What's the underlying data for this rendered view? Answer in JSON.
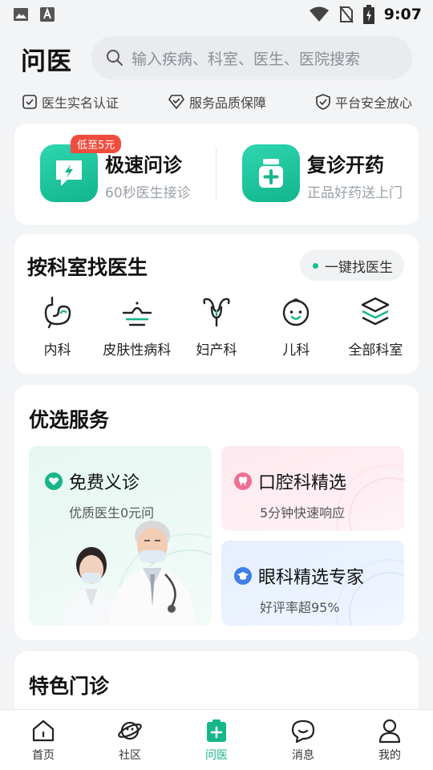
{
  "status_bar": {
    "time": "9:07"
  },
  "header": {
    "title": "问医",
    "search_placeholder": "输入疾病、科室、医生、医院搜索"
  },
  "trust": [
    {
      "label": "医生实名认证",
      "icon": "checkbox-icon"
    },
    {
      "label": "服务品质保障",
      "icon": "diamond-check-icon"
    },
    {
      "label": "平台安全放心",
      "icon": "shield-check-icon"
    }
  ],
  "quick": {
    "consult": {
      "badge": "低至5元",
      "title": "极速问诊",
      "subtitle": "60秒医生接诊"
    },
    "refill": {
      "title": "复诊开药",
      "subtitle": "正品好药送上门"
    }
  },
  "department": {
    "title": "按科室找医生",
    "find_button": "一键找医生",
    "items": [
      {
        "label": "内科",
        "icon": "stomach-icon"
      },
      {
        "label": "皮肤性病科",
        "icon": "skin-icon"
      },
      {
        "label": "妇产科",
        "icon": "uterus-icon"
      },
      {
        "label": "儿科",
        "icon": "baby-face-icon"
      },
      {
        "label": "全部科室",
        "icon": "layers-icon"
      }
    ]
  },
  "services": {
    "title": "优选服务",
    "free": {
      "title": "免费义诊",
      "subtitle": "优质医生0元问"
    },
    "dental": {
      "title": "口腔科精选",
      "subtitle": "5分钟快速响应"
    },
    "eye": {
      "title": "眼科精选专家",
      "subtitle": "好评率超95%"
    }
  },
  "featured": {
    "title": "特色门诊"
  },
  "tabbar": [
    {
      "label": "首页",
      "icon": "home-icon"
    },
    {
      "label": "社区",
      "icon": "planet-icon"
    },
    {
      "label": "问医",
      "icon": "medical-kit-icon",
      "active": true
    },
    {
      "label": "消息",
      "icon": "chat-bubble-icon"
    },
    {
      "label": "我的",
      "icon": "person-icon"
    }
  ],
  "colors": {
    "accent": "#16b68a",
    "badge": "#f04c3e",
    "pink_icon": "#ee6f8f",
    "blue_icon": "#3f7fe6"
  }
}
